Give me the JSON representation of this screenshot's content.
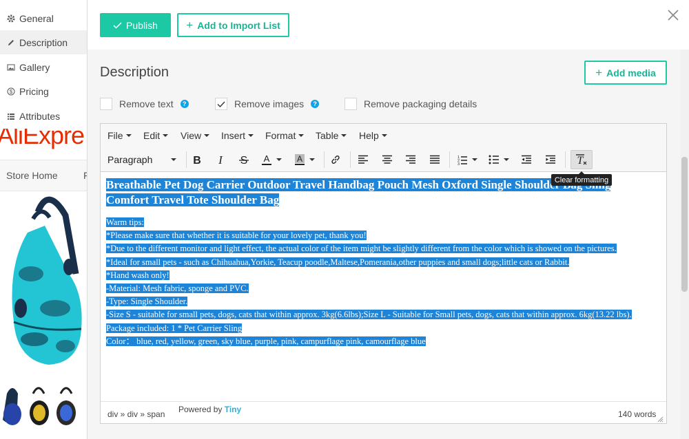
{
  "background_store": {
    "logo_text": "AliExpre",
    "nav_home": "Store Home",
    "nav_next_fragment": "F"
  },
  "tabs": [
    {
      "label": "General",
      "icon": "gear-icon"
    },
    {
      "label": "Description",
      "icon": "pencil-icon"
    },
    {
      "label": "Gallery",
      "icon": "image-icon"
    },
    {
      "label": "Pricing",
      "icon": "dollar-icon"
    },
    {
      "label": "Attributes",
      "icon": "list-icon"
    }
  ],
  "active_tab": "Description",
  "header": {
    "publish_label": "Publish",
    "import_label": "Add to Import List"
  },
  "section": {
    "title": "Description",
    "add_media_label": "Add media"
  },
  "options": [
    {
      "label": "Remove text",
      "checked": false,
      "help": true
    },
    {
      "label": "Remove images",
      "checked": true,
      "help": true
    },
    {
      "label": "Remove packaging details",
      "checked": false,
      "help": false
    }
  ],
  "editor": {
    "menu": [
      "File",
      "Edit",
      "View",
      "Insert",
      "Format",
      "Table",
      "Help"
    ],
    "block_format": "Paragraph",
    "tooltip": "Clear formatting",
    "title_text": "Breathable Pet Dog Carrier Outdoor Travel Handbag Pouch Mesh Oxford Single Shoulder Bag Sling Comfort Travel Tote Shoulder Bag",
    "lines": [
      "Warm tips:",
      "*Please make sure that whether it is suitable for your lovely pet, thank you!",
      "*Due to the different monitor and light effect, the actual color of the item might be slightly different from the color which is showed on the pictures.",
      "*Ideal for small pets - such as Chihuahua,Yorkie, Teacup poodle,Maltese,Pomerania,other puppies and small dogs;little cats or Rabbit.",
      "*Hand wash only!",
      "-Material: Mesh fabric, sponge and PVC.",
      "-Type: Single Shoulder.",
      "-Size S - suitable for small pets, dogs, cats that within approx. 3kg(6.6lbs);Size L - Suitable for Small pets, dogs, cats that within approx. 6kg(13.22 lbs).",
      "Package included: 1 * Pet Carrier Sling",
      "Color： blue, red, yellow, green, sky blue, purple, pink, campurflage pink, camourflage blue"
    ],
    "path": "div » div » span",
    "powered_prefix": "Powered by",
    "powered_brand": "Tiny",
    "word_count": "140 words"
  },
  "colors": {
    "accent": "#1dc8a4",
    "selection": "#1d84d8",
    "help": "#10a2e6",
    "brand_red": "#e62e04"
  }
}
